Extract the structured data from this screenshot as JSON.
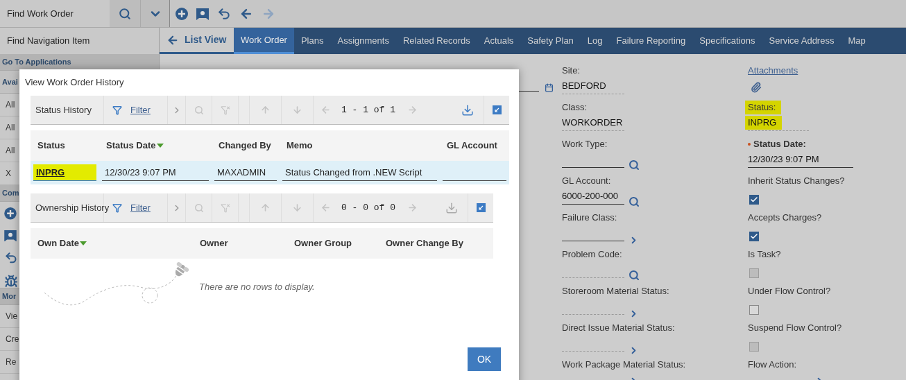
{
  "top_bar": {
    "search_value": "Find Work Order"
  },
  "sidebar": {
    "search_value": "Find Navigation Item",
    "rows": [
      {
        "kind": "header",
        "text": "Go To Applications"
      },
      {
        "kind": "subheader",
        "text": "Avai"
      },
      {
        "kind": "item",
        "text": "All"
      },
      {
        "kind": "item",
        "text": "All"
      },
      {
        "kind": "item",
        "text": "All"
      },
      {
        "kind": "item",
        "text": "X"
      },
      {
        "kind": "header",
        "text": "Com"
      },
      {
        "kind": "icons"
      },
      {
        "kind": "header",
        "text": "Mor"
      },
      {
        "kind": "item",
        "text": "Vie"
      },
      {
        "kind": "item",
        "text": "Cre"
      },
      {
        "kind": "item",
        "text": "Re"
      }
    ]
  },
  "back_link": "List View",
  "tabs": [
    {
      "label": "Work Order",
      "selected": true
    },
    {
      "label": "Plans",
      "selected": false
    },
    {
      "label": "Assignments",
      "selected": false
    },
    {
      "label": "Related Records",
      "selected": false
    },
    {
      "label": "Actuals",
      "selected": false
    },
    {
      "label": "Safety Plan",
      "selected": false
    },
    {
      "label": "Log",
      "selected": false
    },
    {
      "label": "Failure Reporting",
      "selected": false
    },
    {
      "label": "Specifications",
      "selected": false
    },
    {
      "label": "Service Address",
      "selected": false
    },
    {
      "label": "Map",
      "selected": false
    }
  ],
  "form": {
    "left": [
      {
        "kind": "text",
        "label": "Site:",
        "value": "BEDFORD",
        "readonly": true,
        "highlighted": false
      },
      {
        "kind": "text",
        "label": "Class:",
        "value": "WORKORDER",
        "readonly": true,
        "highlighted": false
      },
      {
        "kind": "lookup",
        "label": "Work Type:",
        "readonly": false
      },
      {
        "kind": "lookup",
        "label": "GL Account:",
        "value": "6000-200-000",
        "readonly": false,
        "highlighted": false
      },
      {
        "kind": "menu",
        "label": "Failure Class:",
        "readonly": false
      },
      {
        "kind": "lookup",
        "label": "Problem Code:",
        "readonly": true
      },
      {
        "kind": "menu",
        "label": "Storeroom Material Status:",
        "readonly": true
      },
      {
        "kind": "menu",
        "label": "Direct Issue Material Status:",
        "readonly": true
      },
      {
        "kind": "menu",
        "label": "Work Package Material Status:"
      }
    ],
    "right": [
      {
        "kind": "link",
        "label": "Attachments"
      },
      {
        "kind": "text",
        "label": "Status:",
        "value": "INPRG",
        "readonly": true,
        "highlighted": true
      },
      {
        "kind": "text",
        "label": "Status Date:",
        "value": "12/30/23 9:07 PM",
        "readonly": false,
        "required": true,
        "highlighted": false
      },
      {
        "kind": "checkbox",
        "label": "Inherit Status Changes?",
        "checked": true,
        "disabled": false
      },
      {
        "kind": "checkbox",
        "label": "Accepts Charges?",
        "checked": true,
        "disabled": false
      },
      {
        "kind": "checkbox",
        "label": "Is Task?",
        "checked": false,
        "disabled": true
      },
      {
        "kind": "checkbox",
        "label": "Under Flow Control?",
        "checked": false,
        "disabled": false
      },
      {
        "kind": "checkbox",
        "label": "Suspend Flow Control?",
        "checked": false,
        "disabled": true
      },
      {
        "kind": "menu",
        "label": "Flow Action:"
      }
    ]
  },
  "dialog": {
    "title": "View Work Order History",
    "status_history": {
      "title": "Status History",
      "filter": "Filter",
      "count": "1 - 1 of 1",
      "columns": [
        {
          "label": "Status",
          "sorted": false
        },
        {
          "label": "Status Date",
          "sorted": true
        },
        {
          "label": "Changed By",
          "sorted": false
        },
        {
          "label": "Memo",
          "sorted": false
        },
        {
          "label": "GL Account",
          "sorted": false
        }
      ],
      "rows": [
        {
          "cells": [
            {
              "text": "INPRG",
              "highlighted": true
            },
            {
              "text": "12/30/23 9:07 PM",
              "highlighted": false
            },
            {
              "text": "MAXADMIN",
              "highlighted": false
            },
            {
              "text": "Status Changed from .NEW Script",
              "highlighted": false
            }
          ]
        }
      ]
    },
    "ownership_history": {
      "title": "Ownership History",
      "filter": "Filter",
      "count": "0 - 0 of 0",
      "columns": [
        {
          "label": "Own Date",
          "sorted": true
        },
        {
          "label": "Owner",
          "sorted": false
        },
        {
          "label": "Owner Group",
          "sorted": false
        },
        {
          "label": "Owner Change By",
          "sorted": false
        }
      ],
      "empty_message": "There are no rows to display."
    },
    "ok_button": "OK"
  }
}
